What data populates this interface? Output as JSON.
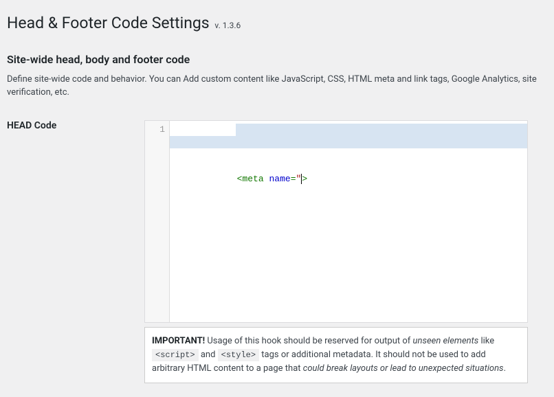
{
  "page": {
    "title": "Head & Footer Code Settings",
    "version": "v. 1.3.6"
  },
  "section": {
    "title": "Site-wide head, body and footer code",
    "description": "Define site-wide code and behavior. You can Add custom content like JavaScript, CSS, HTML meta and link tags, Google Analytics, site verification, etc."
  },
  "field": {
    "label": "HEAD Code",
    "gutter_line": "1",
    "code_tokens": {
      "open": "<",
      "tag": "meta",
      "space": " ",
      "attr": "name",
      "eq": "=",
      "quote": "\"",
      "after": ">"
    }
  },
  "note": {
    "strong": "IMPORTANT!",
    "t1": " Usage of this hook should be reserved for output of ",
    "em1": "unseen elements",
    "t2": " like ",
    "code1": "<script>",
    "t3": " and ",
    "code2": "<style>",
    "t4": " tags or additional metadata. It should not be used to add arbitrary HTML content to a page that ",
    "em2": "could break layouts or lead to unexpected situations",
    "t5": "."
  }
}
